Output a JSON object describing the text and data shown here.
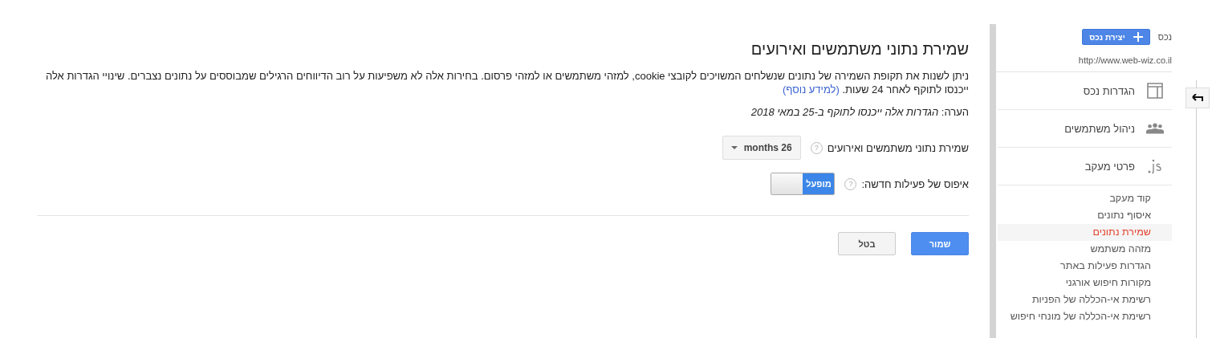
{
  "sidebar": {
    "property_label": "נכס",
    "create_button": "יצירת נכס",
    "url": "http://www.web-wiz.co.il",
    "sections": [
      {
        "label": "הגדרות נכס"
      },
      {
        "label": "ניהול משתמשים"
      },
      {
        "label": "פרטי מעקב"
      }
    ],
    "items": [
      {
        "label": "קוד מעקב",
        "selected": false
      },
      {
        "label": "איסוף נתונים",
        "selected": false
      },
      {
        "label": "שמירת נתונים",
        "selected": true
      },
      {
        "label": "מזהה משתמש",
        "selected": false
      },
      {
        "label": "הגדרות פעילות באתר",
        "selected": false
      },
      {
        "label": "מקורות חיפוש אורגני",
        "selected": false
      },
      {
        "label": "רשימת אי-הכללה של הפניות",
        "selected": false
      },
      {
        "label": "רשימת אי-הכללה של מונחי חיפוש",
        "selected": false
      }
    ]
  },
  "main": {
    "title": "שמירת נתוני משתמשים ואירועים",
    "description": "ניתן לשנות את תקופת השמירה של נתונים שנשלחים המשויכים לקובצי cookie, למזהי משתמשים או למזהי פרסום. בחירות אלה לא משפיעות על רוב הדיווחים הרגילים שמבוססים על נתונים נצברים. שינויי הגדרות אלה ייכנסו לתוקף לאחר 24 שעות.",
    "learn_more": "(למידע נוסף)",
    "note": "הערה: *הגדרות אלה ייכנסו לתוקף ב-25 במאי 2018*",
    "retention": {
      "label": "שמירת נתוני משתמשים ואירועים",
      "help": "?",
      "value": "26 months"
    },
    "reset": {
      "label": "איפוס של פעילות חדשה:",
      "help": "?",
      "on": true,
      "state_label": "מופעל"
    },
    "buttons": [
      {
        "label": "שמור",
        "kind": "primary"
      },
      {
        "label": "בטל",
        "kind": "secondary"
      }
    ]
  }
}
